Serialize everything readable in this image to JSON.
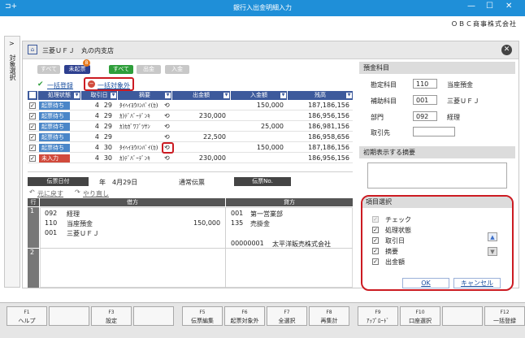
{
  "window": {
    "title": "銀行入出金明細入力",
    "company": "ＯＢＣ商事株式会社"
  },
  "side": {
    "label": "対象選択"
  },
  "bank": {
    "name": "三菱ＵＦＪ　丸の内支店"
  },
  "filters": {
    "all": "すべて",
    "unprocessed": "未起票",
    "unprocessed_count": "8",
    "all2": "すべて",
    "withdrawal": "出金",
    "deposit": "入金"
  },
  "actions": {
    "bulk_register": "一括登録",
    "bulk_exclude": "一括対象外"
  },
  "grid": {
    "headers": {
      "status": "処理状態",
      "date": "取引日",
      "summary": "摘要",
      "withdrawal": "出金額",
      "deposit": "入金額",
      "balance": "残高"
    },
    "rows": [
      {
        "status": "起票待ち",
        "month": "4",
        "day": "29",
        "summary": "ﾀｲﾍｲﾖｳﾊﾝﾊﾞｲ(ｶ)",
        "withdrawal": "",
        "deposit": "150,000",
        "balance": "187,186,156"
      },
      {
        "status": "起票待ち",
        "month": "4",
        "day": "29",
        "summary": "ｶ)ﾃﾞﾊﾞｰﾃﾞﾝｷ",
        "withdrawal": "230,000",
        "deposit": "",
        "balance": "186,956,156"
      },
      {
        "status": "起票待ち",
        "month": "4",
        "day": "29",
        "summary": "ｶ)ｶｶﾞﾜﾌﾞﾂｻﾝ",
        "withdrawal": "",
        "deposit": "25,000",
        "balance": "186,981,156"
      },
      {
        "status": "起票待ち",
        "month": "4",
        "day": "29",
        "summary": "",
        "withdrawal": "22,500",
        "deposit": "",
        "balance": "186,958,656"
      },
      {
        "status": "起票待ち",
        "month": "4",
        "day": "30",
        "summary": "ﾀｲﾍｲﾖｳﾊﾝﾊﾞｲ(ｶ)",
        "withdrawal": "",
        "deposit": "150,000",
        "balance": "187,186,156"
      },
      {
        "status": "未入力",
        "month": "4",
        "day": "30",
        "summary": "ｶ)ﾃﾞﾊﾞｰﾃﾞﾝｷ",
        "withdrawal": "230,000",
        "deposit": "",
        "balance": "186,956,156"
      }
    ]
  },
  "voucher": {
    "date_label": "伝票日付",
    "date_value": "年　4月29日",
    "type": "通常伝票",
    "no_label": "伝票No."
  },
  "undo": {
    "undo": "元に戻す",
    "redo": "やり直し"
  },
  "journal": {
    "headers": {
      "line": "行",
      "debit": "借方",
      "credit": "貸方"
    },
    "line1": "1",
    "line2": "2",
    "debit_dept_code": "092",
    "debit_dept": "経理",
    "debit_acct_code": "110",
    "debit_acct": "当座預金",
    "debit_amount": "150,000",
    "debit_sub_code": "001",
    "debit_sub": "三菱ＵＦＪ",
    "credit_dept_code": "001",
    "credit_dept": "第一営業部",
    "credit_acct_code": "135",
    "credit_acct": "売掛金",
    "credit_partner_code": "00000001",
    "credit_partner": "太平洋販売株式会社"
  },
  "right": {
    "deposit_section": "預金科目",
    "acct_label": "勘定科目",
    "acct_code": "110",
    "acct_name": "当座預金",
    "sub_label": "補助科目",
    "sub_code": "001",
    "sub_name": "三菱ＵＦＪ",
    "dept_label": "部門",
    "dept_code": "092",
    "dept_name": "経理",
    "partner_label": "取引先",
    "summary_section": "初期表示する摘要"
  },
  "itempanel": {
    "title": "項目選択",
    "items": [
      "チェック",
      "処理状態",
      "取引日",
      "摘要",
      "出金額"
    ],
    "ok": "OK",
    "cancel": "キャンセル"
  },
  "fkeys": [
    {
      "key": "F1",
      "label": "ヘルプ"
    },
    {
      "key": "",
      "label": ""
    },
    {
      "key": "F3",
      "label": "設定"
    },
    {
      "key": "",
      "label": ""
    },
    {
      "key": "F5",
      "label": "伝票編集"
    },
    {
      "key": "F6",
      "label": "起票対象外"
    },
    {
      "key": "F7",
      "label": "全選択"
    },
    {
      "key": "F8",
      "label": "再集計"
    },
    {
      "key": "F9",
      "label": "ｱｯﾌﾟﾛｰﾄﾞ"
    },
    {
      "key": "F10",
      "label": "口座選択"
    },
    {
      "key": "",
      "label": ""
    },
    {
      "key": "F12",
      "label": "一括登録"
    }
  ]
}
